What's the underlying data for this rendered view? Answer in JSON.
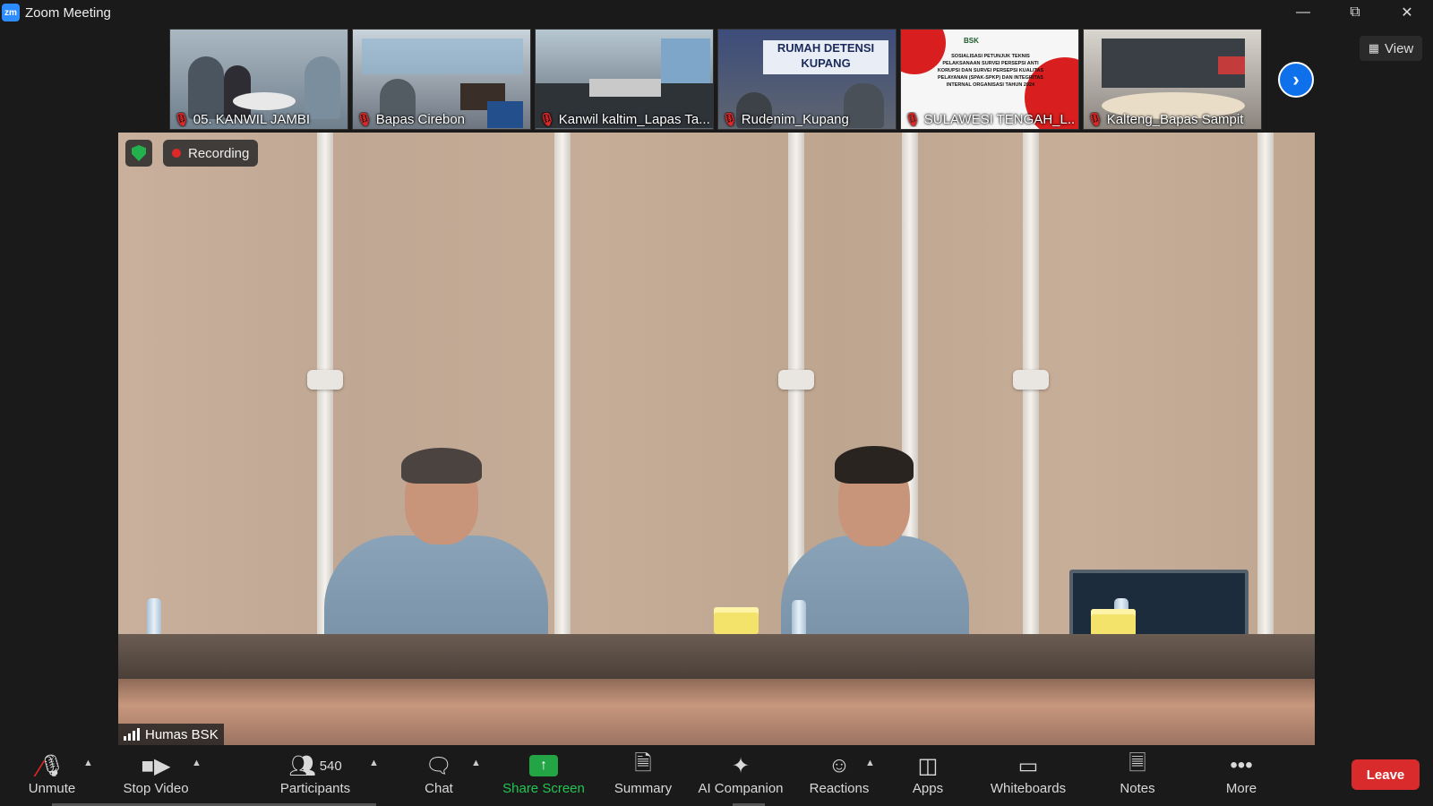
{
  "window": {
    "title": "Zoom Meeting",
    "logo_text": "zm",
    "controls": [
      "minimize",
      "restore",
      "close"
    ]
  },
  "gallery": {
    "thumbnails": [
      {
        "name": "05. KANWIL JAMBI",
        "muted": true,
        "bg": "#8a9aa6"
      },
      {
        "name": "Bapas Cirebon",
        "muted": true,
        "bg": "#7c8590"
      },
      {
        "name": "Kanwil kaltim_Lapas Ta...",
        "muted": true,
        "bg": "#7f8c99"
      },
      {
        "name": "Rudenim_Kupang",
        "muted": true,
        "bg": "#5b6a8a"
      },
      {
        "name": "SULAWESI TENGAH_L...",
        "muted": true,
        "bg": "#f2f2f2"
      },
      {
        "name": "Kalteng_Bapas Sampit",
        "muted": true,
        "bg": "#8d8a86"
      }
    ],
    "next_icon": "chevron-right-icon",
    "view_label": "View"
  },
  "slide": {
    "org": "BSK",
    "title_lines": [
      "SOSIALISASI PETUNJUK TEKNIS",
      "PELAKSANAAN SURVEI PERSEPSI ANTI",
      "KORUPSI DAN SURVEI PERSEPSI KUALITAS",
      "PELAYANAN (SPAK-SPKP) DAN INTEGRITAS",
      "INTERNAL ORGANISASI TAHUN 2024"
    ]
  },
  "sign": {
    "line1": "RUMAH DETENSI",
    "line2": "KUPANG"
  },
  "main": {
    "recording_label": "Recording",
    "speaker_name": "Humas BSK",
    "security_icon": "shield-check-icon"
  },
  "toolbar": {
    "unmute": "Unmute",
    "stop_video": "Stop Video",
    "participants": "Participants",
    "participants_count": "540",
    "chat": "Chat",
    "share_screen": "Share Screen",
    "summary": "Summary",
    "ai_companion": "AI Companion",
    "reactions": "Reactions",
    "apps": "Apps",
    "whiteboards": "Whiteboards",
    "notes": "Notes",
    "more": "More",
    "leave": "Leave"
  },
  "colors": {
    "accent": "#0e71eb",
    "leave": "#d92b2b",
    "share": "#23a445",
    "muted": "#e02828"
  }
}
